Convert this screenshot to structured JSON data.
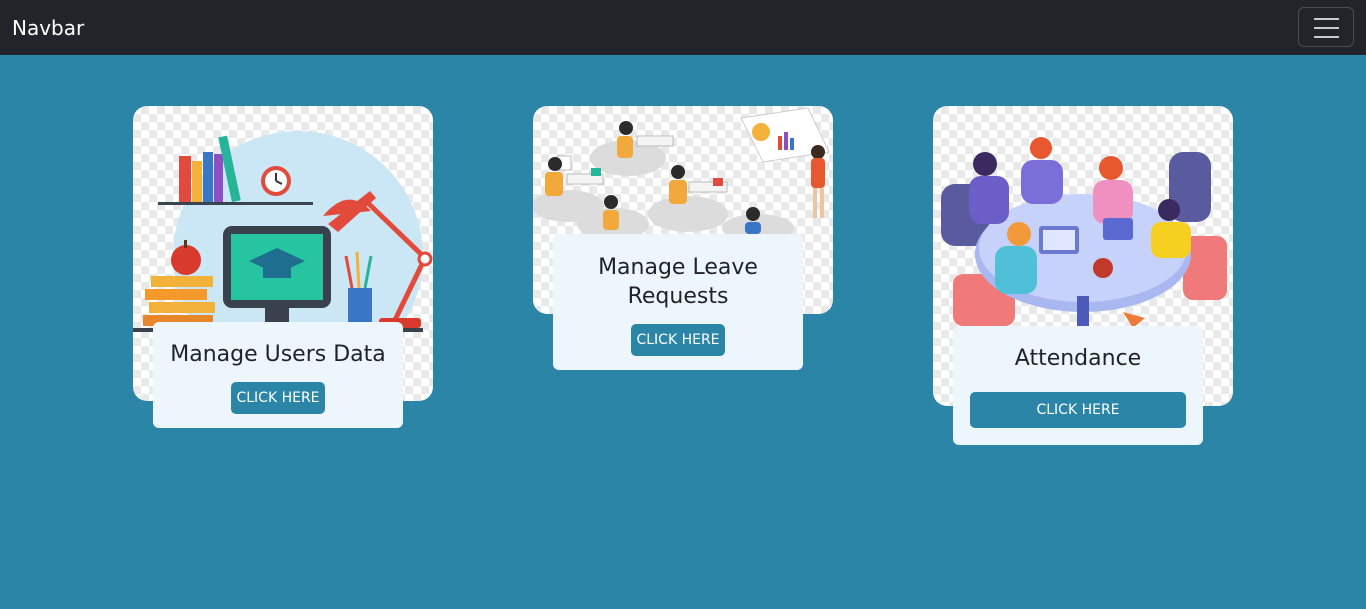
{
  "navbar": {
    "brand": "Navbar"
  },
  "cards": [
    {
      "title": "Manage Users Data",
      "button": "CLICK HERE"
    },
    {
      "title_line1": "Manage Leave",
      "title_line2": "Requests",
      "button": "CLICK HERE"
    },
    {
      "title": "Attendance",
      "button": "CLICK HERE"
    }
  ],
  "colors": {
    "page_background": "#2b85a6",
    "navbar_background": "#212529",
    "panel_background": "#eef6fd",
    "button_background": "#2b85a6"
  }
}
